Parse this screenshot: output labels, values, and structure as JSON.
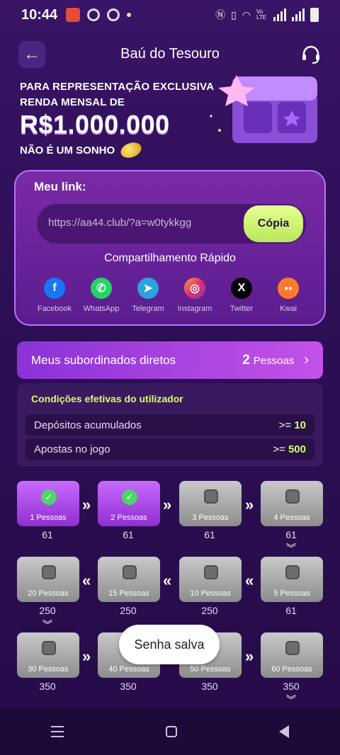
{
  "status_bar": {
    "time": "10:44",
    "network_label": "Vo LTE"
  },
  "header": {
    "title": "Baú do Tesouro"
  },
  "banner": {
    "line1": "PARA REPRESENTAÇÃO EXCLUSIVA",
    "line2": "RENDA MENSAL DE",
    "amount": "R$1.000.000",
    "line3": "NÃO É UM SONHO"
  },
  "link_card": {
    "label": "Meu link:",
    "url": "https://aa44.club/?a=w0tykkgg",
    "copy_label": "Cópia",
    "share_title": "Compartilhamento Rápido",
    "share_items": [
      {
        "label": "Facebook",
        "icon": "facebook-icon",
        "color": "#1877f2",
        "glyph": "f"
      },
      {
        "label": "WhatsApp",
        "icon": "whatsapp-icon",
        "color": "#25d366",
        "glyph": "✆"
      },
      {
        "label": "Telegram",
        "icon": "telegram-icon",
        "color": "#2aa3df",
        "glyph": "➤"
      },
      {
        "label": "Instagram",
        "icon": "instagram-icon",
        "color": "#e1306c",
        "glyph": "◎"
      },
      {
        "label": "Twitter",
        "icon": "x-icon",
        "color": "#000000",
        "glyph": "X"
      },
      {
        "label": "Kwai",
        "icon": "kwai-icon",
        "color": "#ff7a2f",
        "glyph": "●●"
      }
    ]
  },
  "subordinates": {
    "label": "Meus subordinados diretos",
    "count": "2",
    "unit": "Pessoas"
  },
  "conditions": {
    "title": "Condições efetivas do utilizador",
    "rows": [
      {
        "label": "Depósitos acumulados",
        "op": ">=",
        "value": "10"
      },
      {
        "label": "Apostas no jogo",
        "op": ">=",
        "value": "500"
      }
    ]
  },
  "steps": [
    {
      "people": "1 Pessoas",
      "reward": "61",
      "done": true
    },
    {
      "people": "2 Pessoas",
      "reward": "61",
      "done": true
    },
    {
      "people": "3 Pessoas",
      "reward": "61",
      "done": false
    },
    {
      "people": "4 Pessoas",
      "reward": "61",
      "done": false
    },
    {
      "people": "5 Pessoas",
      "reward": "61",
      "done": false
    },
    {
      "people": "10 Pessoas",
      "reward": "250",
      "done": false
    },
    {
      "people": "15 Pessoas",
      "reward": "250",
      "done": false
    },
    {
      "people": "20 Pessoas",
      "reward": "250",
      "done": false
    },
    {
      "people": "30 Pessoas",
      "reward": "350",
      "done": false
    },
    {
      "people": "40 Pessoas",
      "reward": "350",
      "done": false
    },
    {
      "people": "50 Pessoas",
      "reward": "350",
      "done": false
    },
    {
      "people": "60 Pessoas",
      "reward": "350",
      "done": false
    }
  ],
  "toast": {
    "text": "Senha salva"
  }
}
